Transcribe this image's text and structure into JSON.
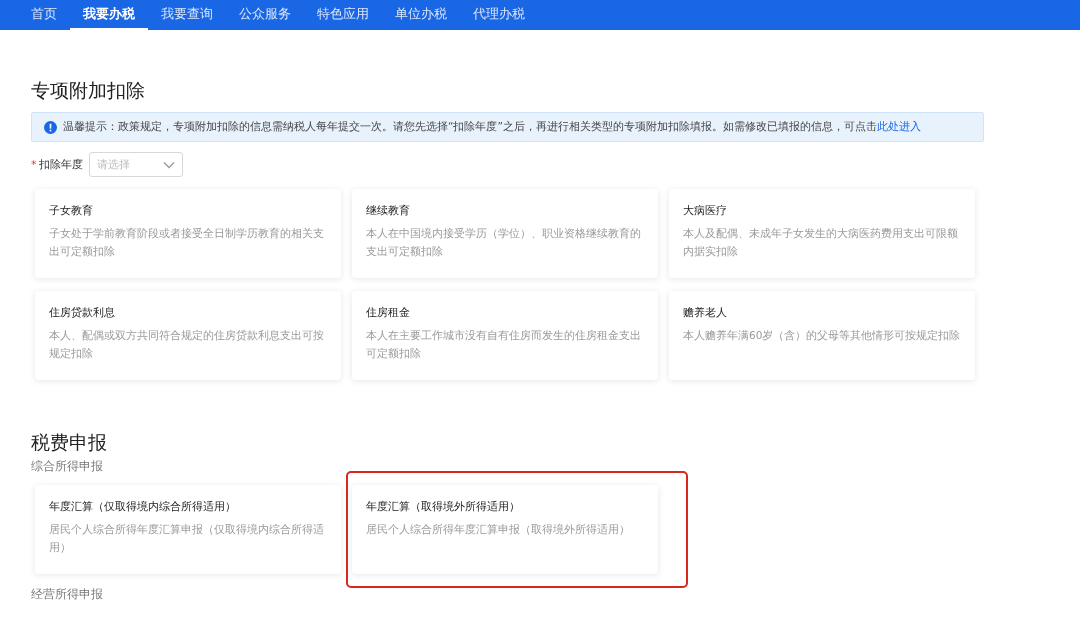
{
  "nav": {
    "items": [
      {
        "label": "首页",
        "selected": false
      },
      {
        "label": "我要办税",
        "selected": true
      },
      {
        "label": "我要查询",
        "selected": false
      },
      {
        "label": "公众服务",
        "selected": false
      },
      {
        "label": "特色应用",
        "selected": false
      },
      {
        "label": "单位办税",
        "selected": false
      },
      {
        "label": "代理办税",
        "selected": false
      }
    ]
  },
  "deduction": {
    "title": "专项附加扣除",
    "notice": {
      "text": "温馨提示：政策规定，专项附加扣除的信息需纳税人每年提交一次。请您先选择“扣除年度”之后，再进行相关类型的专项附加扣除填报。如需修改已填报的信息，可点击",
      "link": "此处进入"
    },
    "year_field": {
      "required_mark": "*",
      "label": "扣除年度",
      "placeholder": "请选择"
    },
    "cards": [
      {
        "title": "子女教育",
        "desc": "子女处于学前教育阶段或者接受全日制学历教育的相关支出可定额扣除"
      },
      {
        "title": "继续教育",
        "desc": "本人在中国境内接受学历（学位）、职业资格继续教育的支出可定额扣除"
      },
      {
        "title": "大病医疗",
        "desc": "本人及配偶、未成年子女发生的大病医药费用支出可限额内据实扣除"
      },
      {
        "title": "住房贷款利息",
        "desc": "本人、配偶或双方共同符合规定的住房贷款利息支出可按规定扣除"
      },
      {
        "title": "住房租金",
        "desc": "本人在主要工作城市没有自有住房而发生的住房租金支出可定额扣除"
      },
      {
        "title": "赡养老人",
        "desc": "本人赡养年满60岁（含）的父母等其他情形可按规定扣除"
      }
    ]
  },
  "filing": {
    "title": "税费申报",
    "groups": [
      {
        "title": "综合所得申报",
        "cards": [
          {
            "title": "年度汇算（仅取得境内综合所得适用）",
            "desc": "居民个人综合所得年度汇算申报（仅取得境内综合所得适用）",
            "highlighted": false
          },
          {
            "title": "年度汇算（取得境外所得适用）",
            "desc": "居民个人综合所得年度汇算申报（取得境外所得适用）",
            "highlighted": true
          }
        ]
      },
      {
        "title": "经营所得申报"
      }
    ]
  }
}
